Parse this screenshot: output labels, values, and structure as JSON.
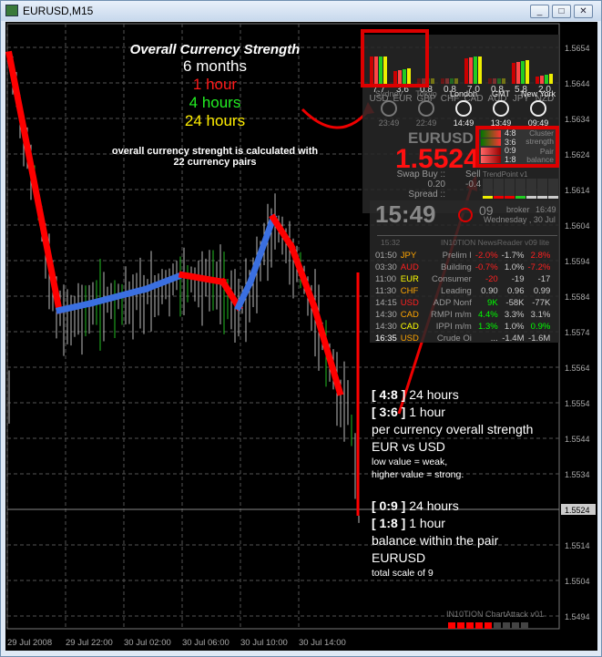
{
  "window": {
    "title": "EURUSD,M15",
    "buttons": [
      "_",
      "□",
      "✕"
    ]
  },
  "annotation": {
    "title": "Overall Currency Strength",
    "period1": "6 months",
    "period2": "1 hour",
    "period3": "4 hours",
    "period4": "24 hours",
    "note1": "overall currency strenght is calculated with",
    "note2": "22 currency pairs",
    "block1": {
      "l1_code": "[ 4:8 ]",
      "l1_text": "24 hours",
      "l2_code": "[ 3:6 ]",
      "l2_text": "1 hour",
      "l3": "per currency overall strength",
      "l4": "EUR  vs  USD",
      "l5": "low value = weak,",
      "l6": "higher value = strong."
    },
    "block2": {
      "l1_code": "[ 0:9 ]",
      "l1_text": "24 hours",
      "l2_code": "[ 1:8 ]",
      "l2_text": "1 hour",
      "l3": "balance within the pair",
      "l4": "EURUSD",
      "l5": "total scale of 9"
    }
  },
  "strength": [
    {
      "code": "USD",
      "value": "7.7"
    },
    {
      "code": "EUR",
      "value": "3.6"
    },
    {
      "code": "GBP",
      "value": "0.8"
    },
    {
      "code": "CHF",
      "value": "0.8"
    },
    {
      "code": "CAD",
      "value": "7.0"
    },
    {
      "code": "AUD",
      "value": "0.8"
    },
    {
      "code": "JPY",
      "value": "5.8"
    },
    {
      "code": "NZD",
      "value": "2.0"
    }
  ],
  "clocks": [
    {
      "city": "Sydney",
      "time": "23:49"
    },
    {
      "city": "Tokyo",
      "time": "22:49"
    },
    {
      "city": "London",
      "time": "14:49"
    },
    {
      "city": "GMT",
      "time": "13:49"
    },
    {
      "city": "New York",
      "time": "09:49"
    }
  ],
  "pair": {
    "symbol": "EURUSD",
    "price": "1.5524",
    "swap_label": "Swap Buy ::",
    "swap_buy": "0.20",
    "sell_label": "Sell",
    "swap_sell": "-0.4",
    "spread_label": "Spread ::",
    "trendpoint": "TrendPoint v1"
  },
  "cluster": {
    "strength_label": "Cluster strength",
    "balance_label": "Pair balance",
    "s24": "4:8",
    "s1": "3:6",
    "b24": "0:9",
    "b1": "1:8"
  },
  "clock": {
    "time": "15:49",
    "seconds": "09",
    "broker_label": "broker",
    "broker_time": "16:49",
    "date": "Wednesday , 30 Jul"
  },
  "news": {
    "time": "15:32",
    "title": "IN10TION NewsReader v09 lite",
    "rows": [
      [
        "01:50",
        "JPY",
        "Prelim I",
        "-2.0%",
        "-1.7%",
        "2.8%"
      ],
      [
        "03:30",
        "AUD",
        "Building",
        "-0.7%",
        "1.0%",
        "-7.2%"
      ],
      [
        "11:00",
        "EUR",
        "Consumer",
        "-20",
        "-19",
        "-17"
      ],
      [
        "11:30",
        "CHF",
        "Leading",
        "0.90",
        "0.96",
        "0.99"
      ],
      [
        "14:15",
        "USD",
        "ADP Nonf",
        "9K",
        "-58K",
        "-77K"
      ],
      [
        "14:30",
        "CAD",
        "RMPI m/m",
        "4.4%",
        "3.3%",
        "3.1%"
      ],
      [
        "14:30",
        "CAD",
        "IPPI m/m",
        "1.3%",
        "1.0%",
        "0.9%"
      ],
      [
        "16:35",
        "USD",
        "Crude Oi",
        "...",
        "-1.4M",
        "-1.6M"
      ]
    ],
    "code_colors": [
      "#ffa500",
      "#ff2020",
      "#ffff00",
      "#ffa500",
      "#ff2020",
      "#ffa500",
      "#ffff00",
      "#ffa500"
    ],
    "actual_colors": [
      "#ff2020",
      "#ff2020",
      "#ff2020",
      "#ccc",
      "#00ff00",
      "#00ff00",
      "#00ff00",
      "#ccc"
    ],
    "prev_colors": [
      "#ff2020",
      "#ff2020",
      "#ccc",
      "#ccc",
      "#ccc",
      "#ccc",
      "#00ff00",
      "#ccc"
    ]
  },
  "chartattack": {
    "label": "IN10TION ChartAttack v01"
  },
  "axis": {
    "prices": [
      "1.5654",
      "1.5644",
      "1.5634",
      "1.5624",
      "1.5614",
      "1.5604",
      "1.5594",
      "1.5584",
      "1.5574",
      "1.5564",
      "1.5554",
      "1.5544",
      "1.5534",
      "1.5524",
      "1.5514",
      "1.5504",
      "1.5494"
    ],
    "current": "1.5524",
    "times": [
      "29 Jul 2008",
      "29 Jul 22:00",
      "30 Jul 02:00",
      "30 Jul 06:00",
      "30 Jul 10:00",
      "30 Jul 14:00"
    ]
  },
  "chart_data": {
    "type": "line",
    "symbol": "EURUSD",
    "timeframe": "M15",
    "ylim": [
      1.549,
      1.566
    ],
    "trend": [
      {
        "t": "29 Jul 18:08",
        "p": 1.5652,
        "c": "red"
      },
      {
        "t": "29 Jul 21:34",
        "p": 1.558,
        "c": "red"
      },
      {
        "t": "29 Jul 23:45",
        "p": 1.5582,
        "c": "blue"
      },
      {
        "t": "30 Jul 03:30",
        "p": 1.5586,
        "c": "blue"
      },
      {
        "t": "30 Jul 06:00",
        "p": 1.559,
        "c": "blue"
      },
      {
        "t": "30 Jul 08:48",
        "p": 1.5588,
        "c": "red"
      },
      {
        "t": "30 Jul 09:52",
        "p": 1.5581,
        "c": "red"
      },
      {
        "t": "30 Jul 10:41",
        "p": 1.5588,
        "c": "blue"
      },
      {
        "t": "30 Jul 12:15",
        "p": 1.5606,
        "c": "blue"
      },
      {
        "t": "30 Jul 13:30",
        "p": 1.5598,
        "c": "red"
      },
      {
        "t": "30 Jul 15:04",
        "p": 1.5581,
        "c": "red"
      },
      {
        "t": "30 Jul 16:49",
        "p": 1.5557,
        "c": "red"
      }
    ],
    "colors": {
      "up": "#3a6fe0",
      "down": "#ff0000",
      "bid_line": "#888888"
    }
  }
}
